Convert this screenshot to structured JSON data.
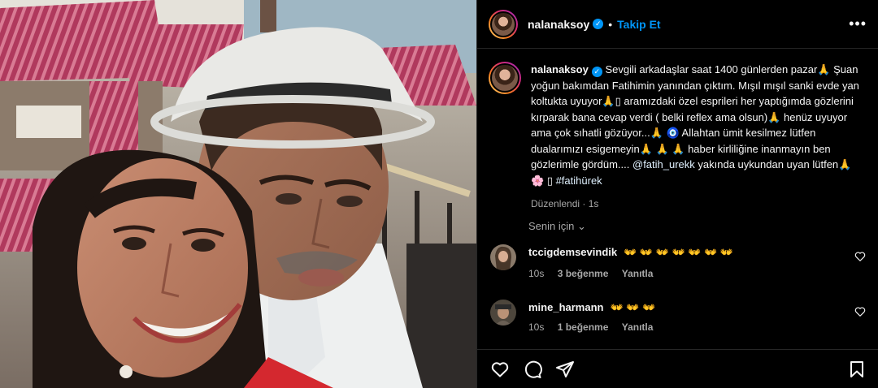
{
  "post": {
    "username": "nalanaksoy",
    "verified_mark": "✓",
    "separator": "•",
    "follow_label": "Takip Et",
    "more_icon": "more-dots-icon",
    "more_label": "•••"
  },
  "caption": {
    "username": "nalanaksoy",
    "text_1": " Sevgili arkadaşlar saat 1400 günlerden pazar🙏 Şuan yoğun bakımdan Fatihimin yanından çıktım. Mışıl mışıl sanki evde yan koltukta uyuyor🙏▯ aramızdaki özel esprileri her yaptığımda gözlerini kırparak bana cevap verdi ( belki reflex ama olsun)🙏 henüz uyuyor ama çok sıhatli gözüyor...🙏 🧿 Allahtan ümit kesilmez lütfen dualarımızı esigemeyin🙏 🙏 🙏 haber kirliliğine inanmayın ben gözlerimle gördüm.... ",
    "mention": "@fatih_urekk",
    "text_2": " yakında uykundan uyan lütfen🙏 🌸 ▯ ",
    "hashtag": "#fatihürek",
    "edited": "Düzenlendi · 1s"
  },
  "for_you": {
    "label": "Senin için",
    "chevron": "⌄"
  },
  "comments": [
    {
      "username": "tccigdemsevindik",
      "text": "👐 👐 👐 👐 👐 👐 👐",
      "time": "10s",
      "likes": "3 beğenme",
      "reply": "Yanıtla"
    },
    {
      "username": "mine_harmann",
      "text": "👐 👐 👐",
      "time": "10s",
      "likes": "1 beğenme",
      "reply": "Yanıtla"
    }
  ],
  "colors": {
    "accent": "#0095f6",
    "muted": "#a8a8a8",
    "text": "#f5f5f5",
    "background": "#000000"
  },
  "icons": {
    "like": "heart-icon",
    "comment": "comment-bubble-icon",
    "share": "paper-plane-icon",
    "save": "bookmark-icon"
  }
}
